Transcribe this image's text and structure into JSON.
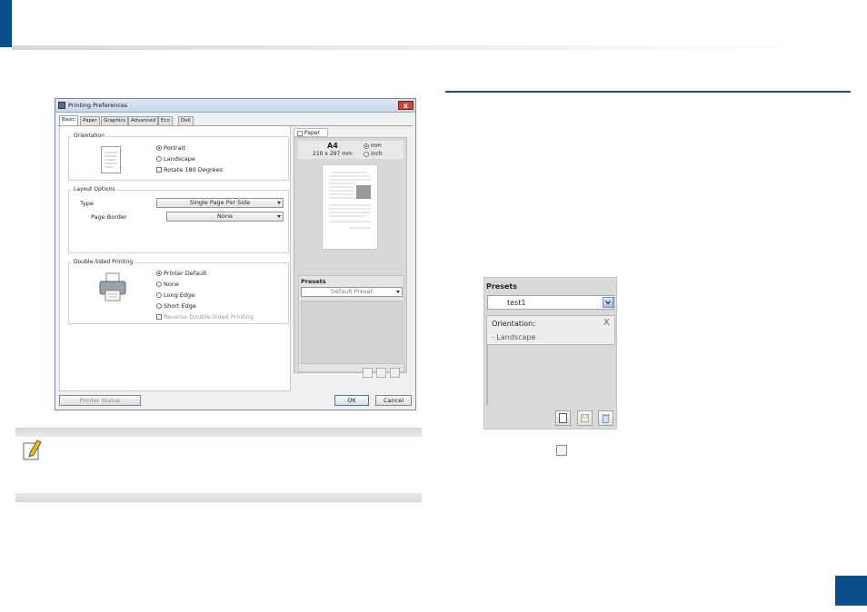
{
  "dialog": {
    "title": "Printing Preferences",
    "close": "x",
    "tabs": [
      "Basic",
      "Paper",
      "Graphics",
      "Advanced",
      "Eco",
      "Dell"
    ],
    "orientation": {
      "title": "Orientation",
      "portrait": "Portrait",
      "landscape": "Landscape",
      "rotate": "Rotate 180 Degrees",
      "selected": "Portrait"
    },
    "layout": {
      "title": "Layout Options",
      "type_label": "Type",
      "type_value": "Single Page Per Side",
      "border_label": "Page Border",
      "border_value": "None"
    },
    "duplex": {
      "title": "Double-Sided Printing",
      "printer_default": "Printer Default",
      "none": "None",
      "long_edge": "Long Edge",
      "short_edge": "Short Edge",
      "reverse": "Reverse Double-Sided Printing",
      "selected": "Printer Default"
    },
    "paper_panel": {
      "tab": "Paper",
      "size": "A4",
      "dimensions": "210 x 297 mm",
      "unit_mm": "mm",
      "unit_inch": "inch",
      "unit_selected": "mm"
    },
    "presets": {
      "title": "Presets",
      "value": "Default Preset"
    },
    "buttons": {
      "printer_status": "Printer Status",
      "ok": "OK",
      "cancel": "Cancel"
    }
  },
  "presets_zoom": {
    "title": "Presets",
    "value": "test1",
    "setting_label": "Orientation:",
    "setting_value": "- Landscape",
    "remove": "X"
  },
  "colors": {
    "accent": "#0b4f8a",
    "rule": "#1c4f86"
  },
  "icons": {
    "note": "note-pencil-icon",
    "new_preset": "new-preset-icon",
    "save_preset": "save-preset-icon",
    "delete_preset": "delete-preset-icon"
  }
}
